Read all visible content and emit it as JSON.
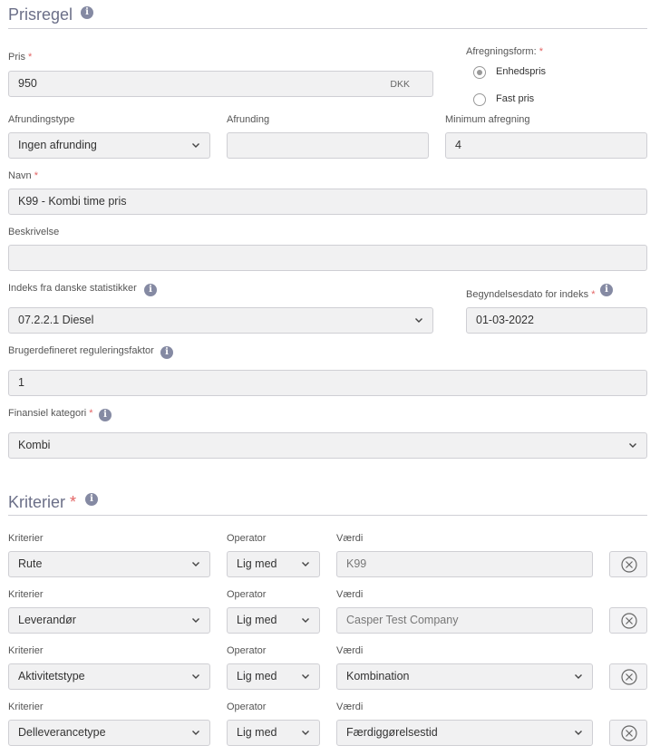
{
  "prisregel": {
    "title": "Prisregel",
    "pris": {
      "label": "Pris",
      "value": "950",
      "suffix": "DKK"
    },
    "afregningsform": {
      "label": "Afregningsform:",
      "options": [
        "Enhedspris",
        "Fast pris"
      ],
      "selected": "Enhedspris"
    },
    "afrundingstype": {
      "label": "Afrundingstype",
      "value": "Ingen afrunding"
    },
    "afrunding": {
      "label": "Afrunding",
      "value": ""
    },
    "minimum_afregning": {
      "label": "Minimum afregning",
      "value": "4"
    },
    "navn": {
      "label": "Navn",
      "value": "K99 - Kombi time pris"
    },
    "beskrivelse": {
      "label": "Beskrivelse",
      "value": ""
    },
    "indeks": {
      "label": "Indeks fra danske statistikker",
      "value": "07.2.2.1 Diesel"
    },
    "begyndelsesdato": {
      "label": "Begyndelsesdato for indeks",
      "value": "01-03-2022"
    },
    "reguleringsfaktor": {
      "label": "Brugerdefineret reguleringsfaktor",
      "value": "1"
    },
    "finansiel_kategori": {
      "label": "Finansiel kategori",
      "value": "Kombi"
    }
  },
  "kriterier": {
    "title": "Kriterier",
    "col_kriterier": "Kriterier",
    "col_operator": "Operator",
    "col_vaerdi": "Værdi",
    "rows": [
      {
        "kriterie": "Rute",
        "operator": "Lig med",
        "vaerdi": "K99"
      },
      {
        "kriterie": "Leverandør",
        "operator": "Lig med",
        "vaerdi": "Casper Test Company"
      },
      {
        "kriterie": "Aktivitetstype",
        "operator": "Lig med",
        "vaerdi": "Kombination"
      },
      {
        "kriterie": "Delleverancetype",
        "operator": "Lig med",
        "vaerdi": "Færdiggørelsestid"
      }
    ]
  },
  "icons": {
    "info": "info-icon",
    "dropdown": "chevron-down-icon",
    "remove": "close-circle-icon"
  },
  "colors": {
    "required": "#e36464",
    "heading": "#6b6f88",
    "field_bg": "#f1f1f2"
  }
}
